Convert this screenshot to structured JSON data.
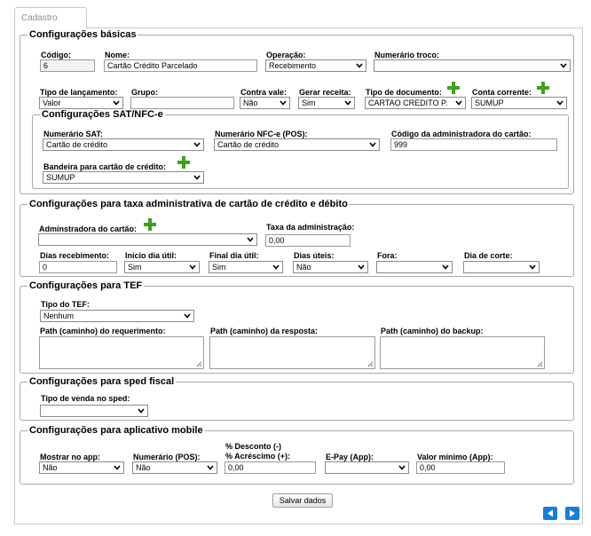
{
  "tab": {
    "label": "Cadastro"
  },
  "basicas": {
    "legend": "Configurações básicas",
    "codigo": {
      "label": "Código:",
      "value": "6"
    },
    "nome": {
      "label": "Nome:",
      "value": "Cartão Crédito Parcelado"
    },
    "operacao": {
      "label": "Operação:",
      "value": "Recebimento"
    },
    "numerario_troco": {
      "label": "Numerário troco:",
      "value": ""
    },
    "tipo_lancamento": {
      "label": "Tipo de lançamento:",
      "value": "Valor"
    },
    "grupo": {
      "label": "Grupo:",
      "value": ""
    },
    "contra_vale": {
      "label": "Contra vale:",
      "value": "Não"
    },
    "gerar_receita": {
      "label": "Gerar receita:",
      "value": "Sim"
    },
    "tipo_documento": {
      "label": "Tipo de documento:",
      "value": "CARTAO CREDITO P."
    },
    "conta_corrente": {
      "label": "Conta corrente:",
      "value": "SUMUP"
    }
  },
  "sat": {
    "legend": "Configurações SAT/NFC-e",
    "numerario_sat": {
      "label": "Numerário SAT:",
      "value": "Cartão de crédito"
    },
    "numerario_nfce": {
      "label": "Numerário NFC-e (POS):",
      "value": "Cartão de crédito"
    },
    "codigo_adm": {
      "label": "Código da administradora do cartão:",
      "value": "999"
    },
    "bandeira": {
      "label": "Bandeira para cartão de crédito:",
      "value": "SUMUP"
    }
  },
  "taxa": {
    "legend": "Configurações para taxa administrativa de cartão de crédito e débito",
    "administradora": {
      "label": "Adminstradora do cartão:",
      "value": ""
    },
    "taxa_adm": {
      "label": "Taxa da administração:",
      "value": "0,00"
    },
    "dias_recebimento": {
      "label": "Dias recebimento:",
      "value": "0"
    },
    "inicio_dia_util": {
      "label": "Inicio dia útil:",
      "value": "Sim"
    },
    "final_dia_util": {
      "label": "Final dia útil:",
      "value": "Sim"
    },
    "dias_uteis": {
      "label": "Dias úteis:",
      "value": "Não"
    },
    "fora": {
      "label": "Fora:",
      "value": ""
    },
    "dia_corte": {
      "label": "Dia de corte:",
      "value": ""
    }
  },
  "tef": {
    "legend": "Configurações para TEF",
    "tipo_tef": {
      "label": "Tipo do TEF:",
      "value": "Nenhum"
    },
    "path_requerimento": {
      "label": "Path (caminho) do requerimento:"
    },
    "path_resposta": {
      "label": "Path (caminho) da resposta:"
    },
    "path_backup": {
      "label": "Path (caminho) do backup:"
    }
  },
  "sped": {
    "legend": "Configurações para sped fiscal",
    "tipo_venda": {
      "label": "Tipo de venda no sped:",
      "value": ""
    }
  },
  "mobile": {
    "legend": "Configurações para aplicativo mobile",
    "mostrar_app": {
      "label": "Mostrar no app:",
      "value": "Não"
    },
    "numerario_pos": {
      "label": "Numerário (POS):",
      "value": "Não"
    },
    "desconto_label1": "% Desconto (-)",
    "desconto_label2": "% Acréscimo (+):",
    "desconto_value": "0,00",
    "epay": {
      "label": "E-Pay (App):",
      "value": ""
    },
    "valor_minimo": {
      "label": "Valor mínimo (App):",
      "value": "0,00"
    }
  },
  "actions": {
    "save_label": "Salvar dados"
  },
  "colors": {
    "accent": "#1a7fd4",
    "plus": "#3da11e"
  },
  "icons": [
    "plus-icon",
    "chevron-down-icon",
    "arrow-left-icon",
    "arrow-right-icon"
  ]
}
